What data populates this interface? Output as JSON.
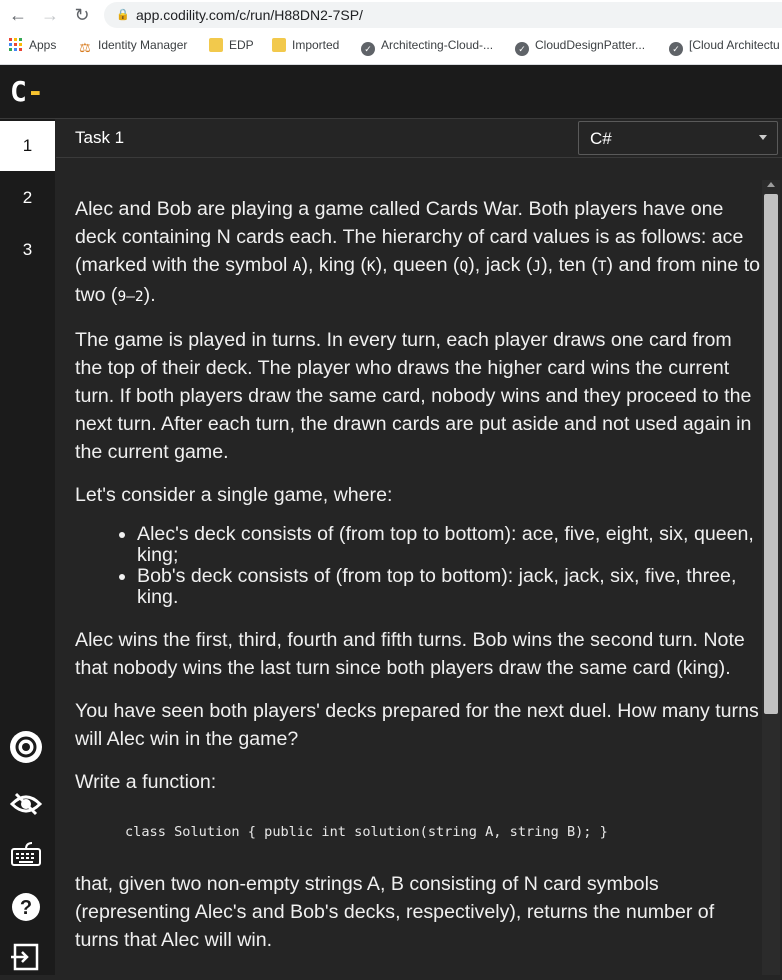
{
  "browser": {
    "url": "app.codility.com/c/run/H88DN2-7SP/",
    "bookmarks": [
      {
        "label": "Apps",
        "icon": "apps-grid-icon"
      },
      {
        "label": "Identity Manager",
        "icon": "identity-manager-icon"
      },
      {
        "label": "EDP",
        "icon": "folder-icon"
      },
      {
        "label": "Imported",
        "icon": "folder-icon"
      },
      {
        "label": "Architecting-Cloud-...",
        "icon": "globe-icon"
      },
      {
        "label": "CloudDesignPatter...",
        "icon": "globe-icon"
      },
      {
        "label": "[Cloud Architectu",
        "icon": "globe-icon"
      }
    ]
  },
  "app": {
    "logo": "C",
    "logo_accent_color": "#f7c32f",
    "tasks": [
      "1",
      "2",
      "3"
    ],
    "active_task": "1",
    "task_title": "Task 1",
    "language": "C#",
    "sidebar_icons": [
      "settings-icon",
      "eye-icon",
      "keyboard-icon",
      "help-icon",
      "exit-icon"
    ]
  },
  "problem": {
    "p1a": "Alec and Bob are playing a game called Cards War. Both players have one deck containing N cards each. The hierarchy of card values is as follows: ace (marked with the symbol ",
    "sym_A": "A",
    "p1b": "), king (",
    "sym_K": "K",
    "p1c": "), queen (",
    "sym_Q": "Q",
    "p1d": "), jack (",
    "sym_J": "J",
    "p1e": "), ten (",
    "sym_T": "T",
    "p1f": ") and from nine to two (",
    "sym_range": "9–2",
    "p1g": ").",
    "p2": "The game is played in turns. In every turn, each player draws one card from the top of their deck. The player who draws the higher card wins the current turn. If both players draw the same card, nobody wins and they proceed to the next turn. After each turn, the drawn cards are put aside and not used again in the current game.",
    "p3": "Let's consider a single game, where:",
    "list": [
      "Alec's deck consists of (from top to bottom): ace, five, eight, six, queen, king;",
      "Bob's deck consists of (from top to bottom): jack, jack, six, five, three, king."
    ],
    "p4": "Alec wins the first, third, fourth and fifth turns. Bob wins the second turn. Note that nobody wins the last turn since both players draw the same card (king).",
    "p5": "You have seen both players' decks prepared for the next duel. How many turns will Alec win in the game?",
    "p6": "Write a function:",
    "code": "class Solution { public int solution(string A, string B); }",
    "p7": "that, given two non-empty strings A, B consisting of N card symbols (representing Alec's and Bob's decks, respectively), returns the number of turns that Alec will win."
  }
}
